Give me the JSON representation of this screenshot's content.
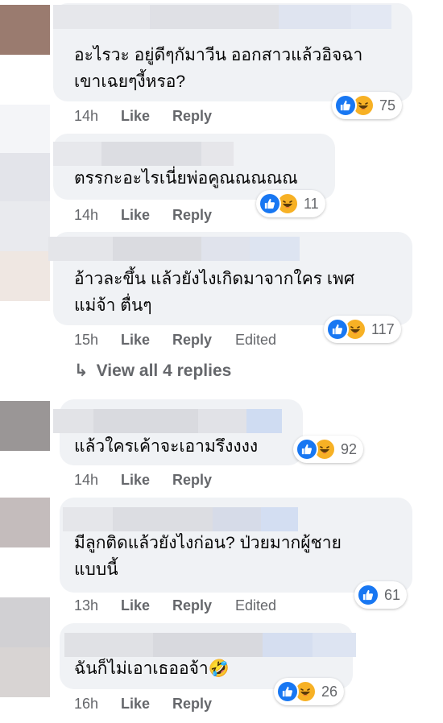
{
  "actions": {
    "like": "Like",
    "reply": "Reply",
    "edited": "Edited"
  },
  "view_replies": {
    "label": "View all 4 replies"
  },
  "comments": [
    {
      "text": "อะไรวะ อยู่ดีๆกัมาวีน ออกสาวแล้วอิจฉา\nเขาเฉยๆงี้หรอ?",
      "time": "14h",
      "reactions": "75",
      "reaction_types": [
        "like-icon",
        "haha-icon"
      ],
      "edited": false
    },
    {
      "text": "ตรรกะอะไรเนี่ยพ่อคูณณณณณ",
      "time": "14h",
      "reactions": "11",
      "reaction_types": [
        "like-icon",
        "haha-icon"
      ],
      "edited": false
    },
    {
      "text": "อ้าวละขึ้น แล้วยังไงเกิดมาจากใคร เพศ\nแม่จ้า ตื่นๆ",
      "time": "15h",
      "reactions": "117",
      "reaction_types": [
        "like-icon",
        "haha-icon"
      ],
      "edited": true
    },
    {
      "text": "แล้วใครเค้าจะเอามรึงงงง",
      "time": "14h",
      "reactions": "92",
      "reaction_types": [
        "like-icon",
        "haha-icon"
      ],
      "edited": false
    },
    {
      "text": "มีลูกติดแล้วยังไงก่อน? ป่วยมากผู้ชาย\nแบบนี้",
      "time": "13h",
      "reactions": "61",
      "reaction_types": [
        "like-icon"
      ],
      "edited": true
    },
    {
      "text": "ฉันก็ไม่เอาเธออจ้า🤣",
      "time": "16h",
      "reactions": "26",
      "reaction_types": [
        "like-icon",
        "haha-icon"
      ],
      "edited": false
    }
  ],
  "colors": {
    "like": "#1877f2",
    "haha": "#f7b125",
    "bubble": "#f0f2f5",
    "meta": "#65676b"
  }
}
